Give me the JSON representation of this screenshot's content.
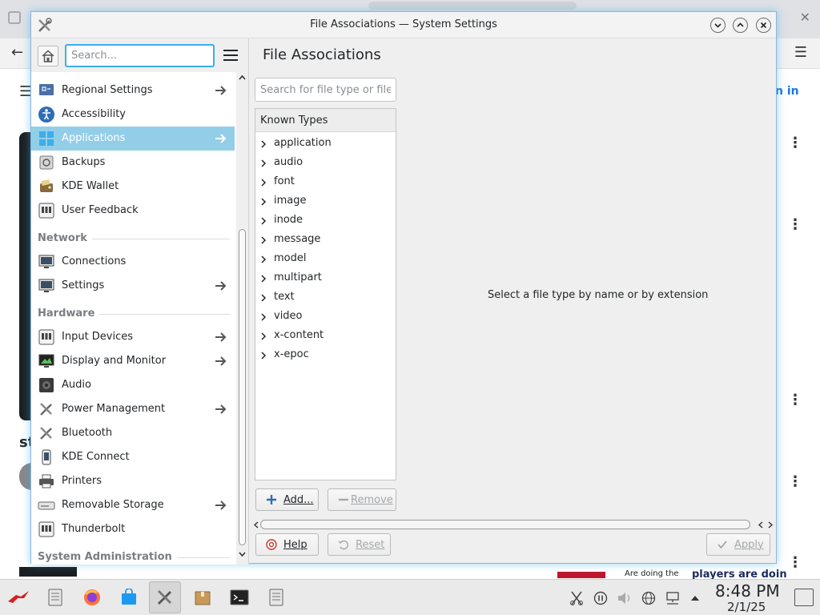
{
  "window": {
    "title": "File Associations — System Settings"
  },
  "sidebar": {
    "search_placeholder": "Search...",
    "items": [
      {
        "label": "Regional Settings",
        "icon": "regional-settings-icon",
        "has_children": true,
        "selected": false
      },
      {
        "label": "Accessibility",
        "icon": "accessibility-icon",
        "has_children": false,
        "selected": false
      },
      {
        "label": "Applications",
        "icon": "applications-icon",
        "has_children": true,
        "selected": true
      },
      {
        "label": "Backups",
        "icon": "backups-icon",
        "has_children": false,
        "selected": false
      },
      {
        "label": "KDE Wallet",
        "icon": "kde-wallet-icon",
        "has_children": false,
        "selected": false
      },
      {
        "label": "User Feedback",
        "icon": "user-feedback-icon",
        "has_children": false,
        "selected": false
      }
    ],
    "sections": [
      {
        "title": "Network",
        "items": [
          {
            "label": "Connections",
            "icon": "connections-icon",
            "has_children": false
          },
          {
            "label": "Settings",
            "icon": "network-settings-icon",
            "has_children": true
          }
        ]
      },
      {
        "title": "Hardware",
        "items": [
          {
            "label": "Input Devices",
            "icon": "input-devices-icon",
            "has_children": true
          },
          {
            "label": "Display and Monitor",
            "icon": "display-monitor-icon",
            "has_children": true
          },
          {
            "label": "Audio",
            "icon": "audio-icon",
            "has_children": false
          },
          {
            "label": "Power Management",
            "icon": "power-management-icon",
            "has_children": true
          },
          {
            "label": "Bluetooth",
            "icon": "bluetooth-icon",
            "has_children": false
          },
          {
            "label": "KDE Connect",
            "icon": "kde-connect-icon",
            "has_children": false
          },
          {
            "label": "Printers",
            "icon": "printers-icon",
            "has_children": false
          },
          {
            "label": "Removable Storage",
            "icon": "removable-storage-icon",
            "has_children": true
          },
          {
            "label": "Thunderbolt",
            "icon": "thunderbolt-icon",
            "has_children": false
          }
        ]
      },
      {
        "title": "System Administration",
        "items": []
      }
    ]
  },
  "main": {
    "title": "File Associations",
    "search_placeholder": "Search for file type or file...",
    "known_types_header": "Known Types",
    "types": [
      "application",
      "audio",
      "font",
      "image",
      "inode",
      "message",
      "model",
      "multipart",
      "text",
      "video",
      "x-content",
      "x-epoc"
    ],
    "empty_message": "Select a file type by name or by extension",
    "add_label": "Add...",
    "remove_label": "Remove",
    "help_label": "Help",
    "reset_label": "Reset",
    "apply_label": "Apply"
  },
  "taskbar": {
    "apps": [
      "app-launcher-icon",
      "document-icon",
      "firefox-icon",
      "store-icon",
      "system-settings-icon",
      "package-icon",
      "terminal-icon",
      "notes-icon"
    ],
    "tray": [
      "clipboard-icon",
      "media-pause-icon",
      "volume-muted-icon",
      "network-globe-icon",
      "network-wired-icon",
      "tray-expand-icon"
    ],
    "time": "8:48 PM",
    "date": "2/1/25"
  },
  "background_browser": {
    "sign_in_fragment": "n in",
    "heading_fragment": "st",
    "caption_1": "Are doing the",
    "caption_2": "players are doin"
  },
  "colors": {
    "accent": "#3daee9",
    "selection": "#93cee9",
    "window_bg": "#efefef",
    "text": "#232629"
  }
}
